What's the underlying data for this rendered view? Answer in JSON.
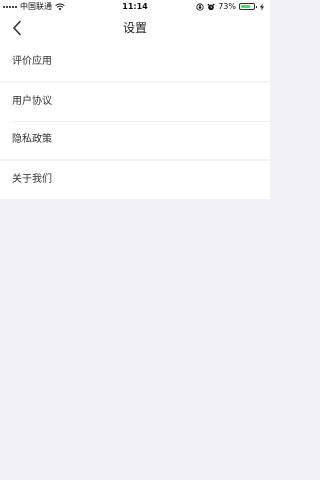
{
  "status_bar": {
    "carrier": "中国联通",
    "time": "11:14",
    "battery_percent": "73%",
    "battery_level": 73,
    "battery_color": "#4cd964"
  },
  "nav": {
    "title": "设置",
    "back_icon": "chevron-left-icon"
  },
  "groups": [
    {
      "items": [
        {
          "label": "评价应用"
        }
      ]
    },
    {
      "items": [
        {
          "label": "用户协议"
        },
        {
          "label": "隐私政策"
        }
      ]
    },
    {
      "items": [
        {
          "label": "关于我们"
        }
      ]
    }
  ],
  "colors": {
    "background": "#f2f2f6",
    "surface": "#ffffff",
    "text": "#333333"
  }
}
